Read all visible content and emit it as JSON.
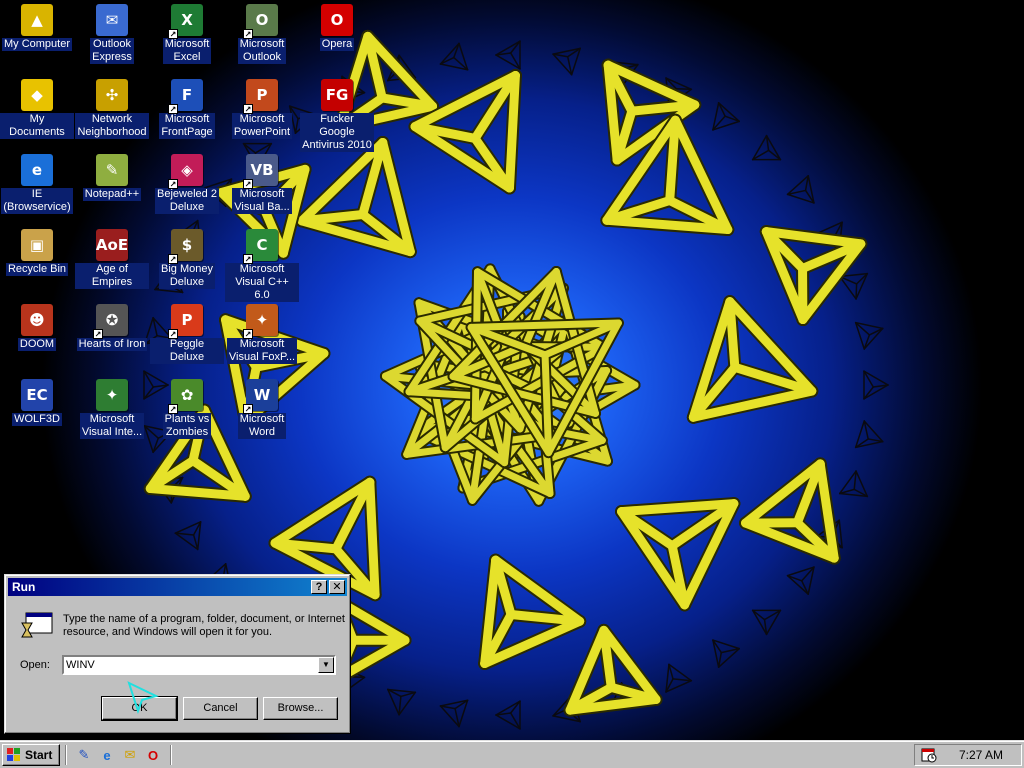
{
  "desktop": {
    "icons": [
      {
        "label": "My Computer",
        "glyph": "▲",
        "color": "#d9b400",
        "shortcut": false
      },
      {
        "label": "My Documents",
        "glyph": "◆",
        "color": "#e8c200",
        "shortcut": false
      },
      {
        "label": "IE\n(Browservice)",
        "glyph": "e",
        "color": "#1a6fd8",
        "shortcut": false
      },
      {
        "label": "Recycle Bin",
        "glyph": "▣",
        "color": "#caa24a",
        "shortcut": false
      },
      {
        "label": "DOOM",
        "glyph": "☻",
        "color": "#b8341c",
        "shortcut": false
      },
      {
        "label": "WOLF3D",
        "glyph": "EC",
        "color": "#2244aa",
        "shortcut": false
      },
      {
        "label": "Outlook\nExpress",
        "glyph": "✉",
        "color": "#3a6ad0",
        "shortcut": false
      },
      {
        "label": "Network\nNeighborhood",
        "glyph": "✣",
        "color": "#c8a000",
        "shortcut": false
      },
      {
        "label": "Notepad++",
        "glyph": "✎",
        "color": "#8fae40",
        "shortcut": false
      },
      {
        "label": "Age of Empires",
        "glyph": "AoE",
        "color": "#9a1e1e",
        "shortcut": false
      },
      {
        "label": "Hearts of Iron",
        "glyph": "✪",
        "color": "#555555",
        "shortcut": true
      },
      {
        "label": "Microsoft\nVisual Inte...",
        "glyph": "✦",
        "color": "#2e7d32",
        "shortcut": false
      },
      {
        "label": "Microsoft\nExcel",
        "glyph": "X",
        "color": "#1e7b34",
        "shortcut": true
      },
      {
        "label": "Microsoft\nFrontPage",
        "glyph": "F",
        "color": "#1d4fb8",
        "shortcut": true
      },
      {
        "label": "Bejeweled 2\nDeluxe",
        "glyph": "◈",
        "color": "#c21c58",
        "shortcut": true
      },
      {
        "label": "Big Money\nDeluxe",
        "glyph": "$",
        "color": "#6b5a2a",
        "shortcut": true
      },
      {
        "label": "Peggle Deluxe",
        "glyph": "P",
        "color": "#d93a1a",
        "shortcut": true
      },
      {
        "label": "Plants vs\nZombies",
        "glyph": "✿",
        "color": "#4a8a2a",
        "shortcut": true
      },
      {
        "label": "Microsoft\nOutlook",
        "glyph": "O",
        "color": "#5a7a4a",
        "shortcut": true
      },
      {
        "label": "Microsoft\nPowerPoint",
        "glyph": "P",
        "color": "#c2491c",
        "shortcut": true
      },
      {
        "label": "Microsoft\nVisual Ba...",
        "glyph": "VB",
        "color": "#4a5a8a",
        "shortcut": true
      },
      {
        "label": "Microsoft\nVisual C++ 6.0",
        "glyph": "C",
        "color": "#2a8a3a",
        "shortcut": true
      },
      {
        "label": "Microsoft\nVisual FoxP...",
        "glyph": "✦",
        "color": "#c25a1a",
        "shortcut": true
      },
      {
        "label": "Microsoft\nWord",
        "glyph": "W",
        "color": "#1b3f9a",
        "shortcut": true
      },
      {
        "label": "Opera",
        "glyph": "O",
        "color": "#d40000",
        "shortcut": false
      },
      {
        "label": "Fucker Google\nAntivirus 2010",
        "glyph": "FG",
        "color": "#c40000",
        "shortcut": false
      }
    ]
  },
  "run_dialog": {
    "title": "Run",
    "help_button": "?",
    "close_button": "✕",
    "description": "Type the name of a program, folder, document, or Internet resource, and Windows will open it for you.",
    "open_label": "Open:",
    "open_value": "WINV",
    "ok_label": "OK",
    "cancel_label": "Cancel",
    "browse_label": "Browse..."
  },
  "taskbar": {
    "start_label": "Start",
    "clock": "7:27 AM",
    "quick_launch": [
      {
        "name": "show-desktop-icon",
        "glyph": "✎",
        "color": "#2050c0"
      },
      {
        "name": "internet-explorer-icon",
        "glyph": "e",
        "color": "#1a6fd8"
      },
      {
        "name": "outlook-express-icon",
        "glyph": "✉",
        "color": "#d0a000"
      },
      {
        "name": "opera-icon",
        "glyph": "O",
        "color": "#d40000"
      }
    ]
  }
}
